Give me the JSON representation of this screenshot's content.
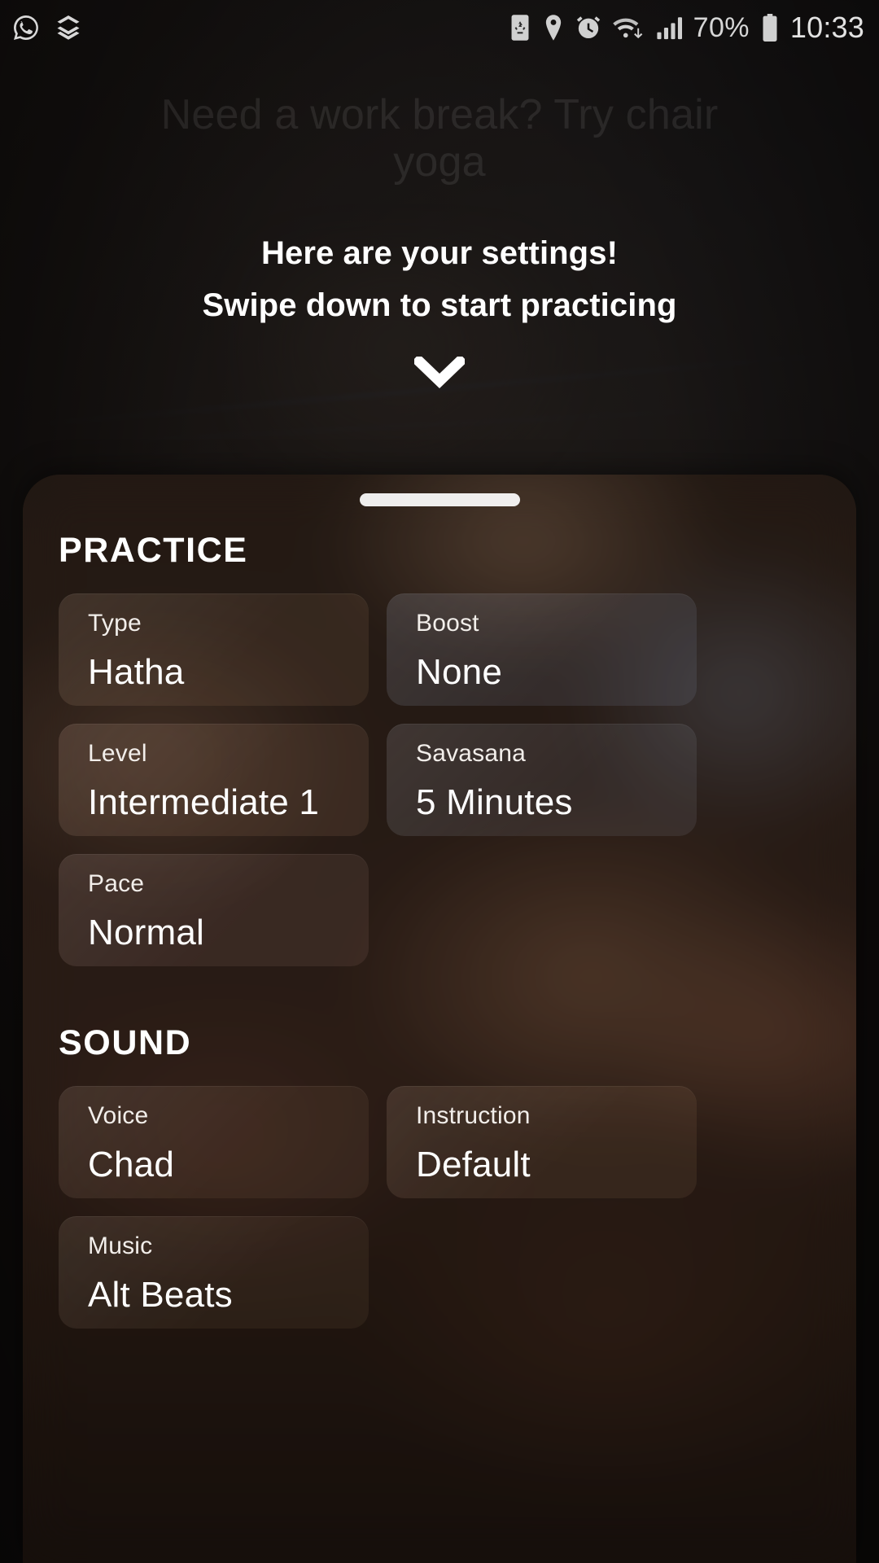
{
  "statusbar": {
    "left_icons": [
      {
        "name": "whatsapp-icon",
        "label": "WhatsApp"
      },
      {
        "name": "layers-notification-icon",
        "label": "Layers"
      }
    ],
    "right_icons": [
      {
        "name": "battery-saver-icon",
        "label": "Battery saver"
      },
      {
        "name": "location-pin-icon",
        "label": "Location"
      },
      {
        "name": "alarm-clock-icon",
        "label": "Alarm"
      },
      {
        "name": "wifi-data-icon",
        "label": "Wi-Fi"
      },
      {
        "name": "cellular-signal-icon",
        "label": "Signal"
      }
    ],
    "battery_percent": "70%",
    "clock": "10:33"
  },
  "hero": {
    "title": "Need a work break? Try chair yoga",
    "subtitle_line1": "Here are your settings!",
    "subtitle_line2": "Swipe down to start practicing",
    "chevron_icon": "chevron-down-icon"
  },
  "sheet": {
    "handle": "drag-handle",
    "sections": [
      {
        "title": "PRACTICE",
        "cards": [
          {
            "label": "Type",
            "value": "Hatha",
            "tint": "tint-warm"
          },
          {
            "label": "Boost",
            "value": "None",
            "tint": "tint-cool"
          },
          {
            "label": "Level",
            "value": "Intermediate 1",
            "tint": "tint-warm2"
          },
          {
            "label": "Savasana",
            "value": "5 Minutes",
            "tint": "tint-cool2"
          },
          {
            "label": "Pace",
            "value": "Normal",
            "tint": "tint-mauve"
          }
        ]
      },
      {
        "title": "SOUND",
        "cards": [
          {
            "label": "Voice",
            "value": "Chad",
            "tint": "tint-brown"
          },
          {
            "label": "Instruction",
            "value": "Default",
            "tint": "tint-brown2"
          },
          {
            "label": "Music",
            "value": "Alt Beats",
            "tint": "tint-brown3"
          }
        ]
      }
    ]
  },
  "colors": {
    "accent_white": "#ffffff",
    "status_text": "#d6d6d6",
    "sheet_warm": "#33221a"
  }
}
